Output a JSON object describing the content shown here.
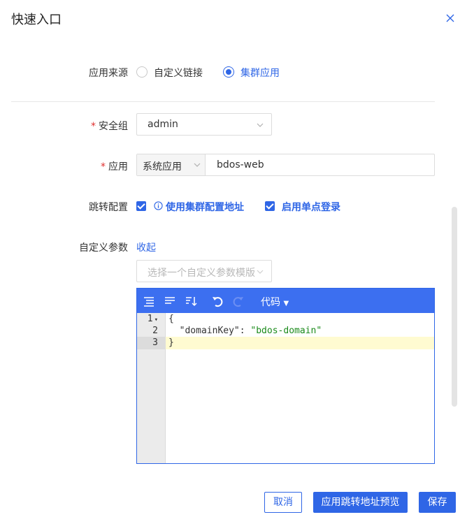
{
  "dialog": {
    "title": "快速入口"
  },
  "form": {
    "source": {
      "label": "应用来源",
      "options": [
        {
          "label": "自定义链接",
          "selected": false
        },
        {
          "label": "集群应用",
          "selected": true
        }
      ]
    },
    "security_group": {
      "label": "安全组",
      "value": "admin"
    },
    "application": {
      "label": "应用",
      "type_value": "系统应用",
      "name_value": "bdos-web"
    },
    "redirect": {
      "label": "跳转配置",
      "use_cluster_address": "使用集群配置地址",
      "enable_sso": "启用单点登录"
    },
    "custom_params": {
      "label": "自定义参数",
      "collapse_link": "收起",
      "template_placeholder": "选择一个自定义参数模版"
    }
  },
  "editor": {
    "mode_label": "代码",
    "lines": [
      {
        "no": "1",
        "fold": "▾"
      },
      {
        "no": "2"
      },
      {
        "no": "3"
      }
    ],
    "code": {
      "open_brace": "{",
      "key": "\"domainKey\"",
      "colon": ": ",
      "value": "\"bdos-domain\"",
      "close_brace": "}"
    }
  },
  "footer": {
    "cancel": "取消",
    "preview": "应用跳转地址预览",
    "save": "保存"
  },
  "colors": {
    "accent": "#2f66e6",
    "toolbar": "#3c6ff0",
    "required": "#e0302f"
  }
}
